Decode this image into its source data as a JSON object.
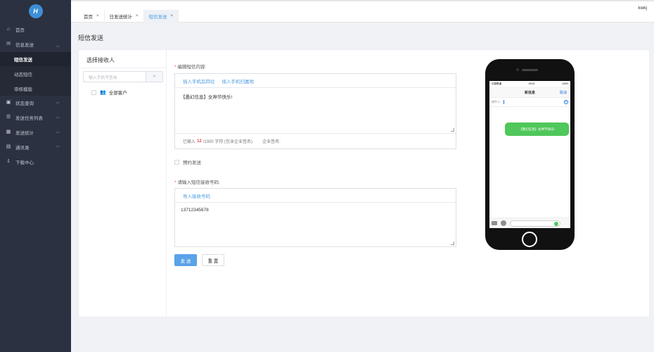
{
  "sidebar": {
    "logo": "H",
    "items": [
      {
        "label": "首页",
        "icon": "home-icon",
        "glyph": "⌂"
      },
      {
        "label": "信息发送",
        "icon": "message-icon",
        "glyph": "✉",
        "expanded": true
      },
      {
        "label": "短信发送",
        "sub": true,
        "active": true
      },
      {
        "label": "动态短信",
        "sub": true
      },
      {
        "label": "审核模版",
        "sub": true
      },
      {
        "label": "状态查询",
        "icon": "chat-icon",
        "glyph": "▣"
      },
      {
        "label": "发送任务列表",
        "icon": "list-icon",
        "glyph": "☰"
      },
      {
        "label": "发送统计",
        "icon": "chart-icon",
        "glyph": "▦"
      },
      {
        "label": "通讯录",
        "icon": "contacts-icon",
        "glyph": "▤"
      },
      {
        "label": "下载中心",
        "icon": "download-icon",
        "glyph": "⇩"
      }
    ]
  },
  "header": {
    "tabs": [
      {
        "label": "首页",
        "close": "×"
      },
      {
        "label": "日发送统计",
        "close": "×"
      },
      {
        "label": "短信发送",
        "close": "×",
        "active": true
      }
    ],
    "user": "kwkj"
  },
  "page_title": "短信发送",
  "recipients": {
    "title": "选择接收人",
    "search_placeholder": "输入手机号查询",
    "tree_item": "全部客户"
  },
  "content_form": {
    "label": "编辑短信内容:",
    "toolbar": [
      "插入手机后四位",
      "插入手机归属地"
    ],
    "text": "【愚幻信息】女神节快乐!",
    "count_prefix": "已输入",
    "count": "12",
    "count_suffix": "/1000 字符 (包含企业签名)",
    "signature_label": "企业签名:"
  },
  "schedule": {
    "label": "预约发送"
  },
  "numbers_form": {
    "label": "请输入短信接收号码:",
    "import_label": "导入接收号码",
    "text": "13712345678"
  },
  "buttons": {
    "send": "发 送",
    "reset": "重 置"
  },
  "phone": {
    "carrier": "中国联通",
    "time": "09:02",
    "battery": "100%",
    "nav_title": "新信息",
    "cancel": "取消",
    "to_label": "收件人:",
    "bubble": "【愚幻信息】女神节快乐!"
  },
  "colors": {
    "accent": "#4a9be0",
    "sidebar": "#2b3140",
    "bubble": "#4fc75a",
    "required": "#e94c4c"
  }
}
